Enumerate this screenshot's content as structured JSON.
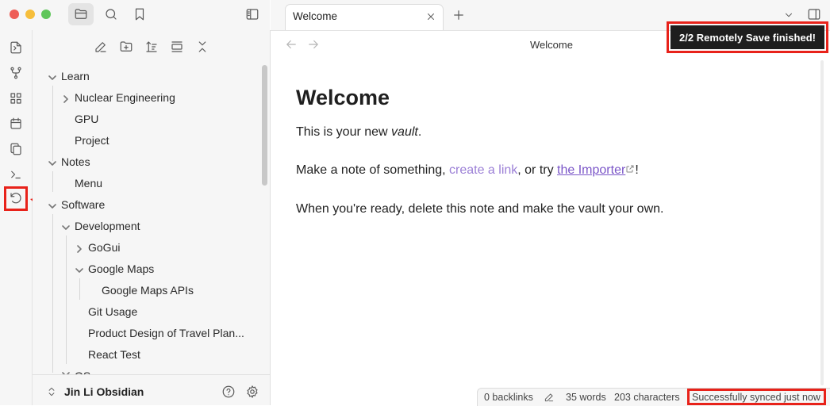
{
  "window": {
    "traffic_lights": [
      "#ee5e57",
      "#f6be3b",
      "#5fc65a"
    ]
  },
  "sidebar": {
    "tree": [
      {
        "label": "Learn"
      },
      {
        "label": "Nuclear Engineering"
      },
      {
        "label": "GPU"
      },
      {
        "label": "Project"
      },
      {
        "label": "Notes"
      },
      {
        "label": "Menu"
      },
      {
        "label": "Software"
      },
      {
        "label": "Development"
      },
      {
        "label": "GoGui"
      },
      {
        "label": "Google Maps"
      },
      {
        "label": "Google Maps APIs"
      },
      {
        "label": "Git Usage"
      },
      {
        "label": "Product Design of Travel Plan..."
      },
      {
        "label": "React Test"
      },
      {
        "label": "OS"
      }
    ],
    "vault_name": "Jin Li Obsidian"
  },
  "tabs": [
    {
      "label": "Welcome"
    }
  ],
  "nav": {
    "title": "Welcome"
  },
  "note": {
    "heading": "Welcome",
    "p1_pre": "This is your new ",
    "p1_em": "vault",
    "p1_post": ".",
    "p2_pre": "Make a note of something, ",
    "p2_link1": "create a link",
    "p2_mid": ", or try ",
    "p2_link2": "the Importer",
    "p2_post": "!",
    "p3": "When you're ready, delete this note and make the vault your own."
  },
  "notice": {
    "text": "2/2 Remotely Save finished!"
  },
  "status_bar": {
    "backlinks": "0 backlinks",
    "words": "35 words",
    "characters": "203 characters",
    "sync": "Successfully synced just now"
  },
  "colors": {
    "accent": "#7b56c8",
    "highlight_box": "#e8221a",
    "notice_bg": "#1e1e1e"
  }
}
